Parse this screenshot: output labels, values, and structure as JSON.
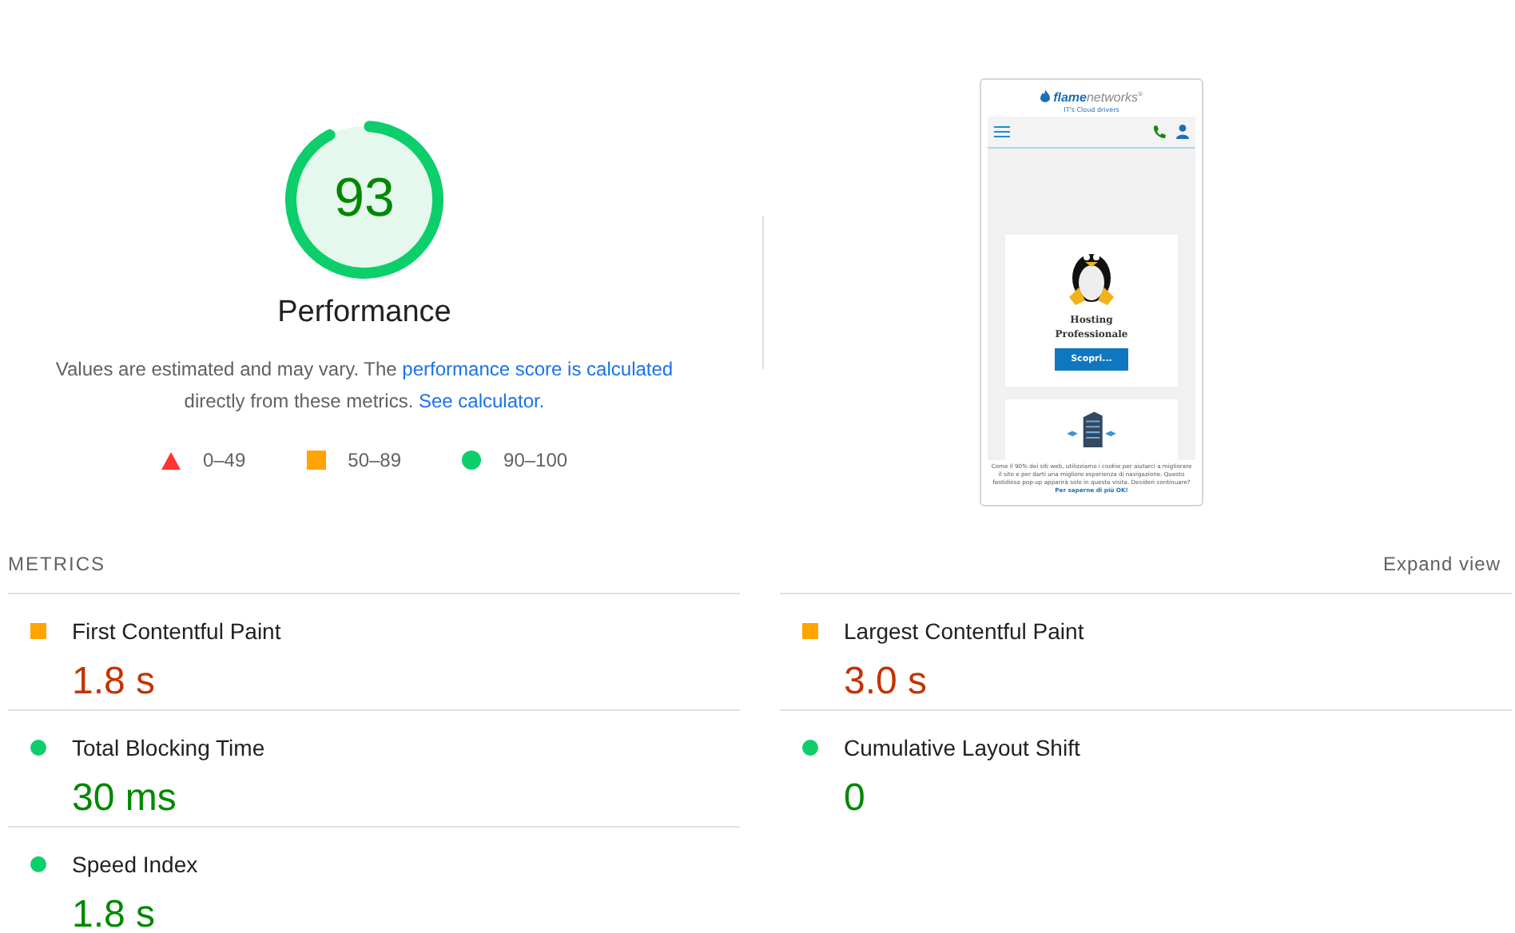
{
  "score": {
    "value": "93",
    "level": 0.93,
    "title": "Performance",
    "note": [
      {
        "kind": "text",
        "text": "Values are estimated and may vary. The "
      },
      {
        "kind": "link",
        "text": "performance score is calculated"
      },
      {
        "kind": "text",
        "text": " directly from these metrics. "
      },
      {
        "kind": "link",
        "text": "See calculator."
      }
    ],
    "legend": [
      {
        "kind": "triangle",
        "color": "#ff3333",
        "range": "0–49"
      },
      {
        "kind": "square",
        "color": "#ffa400",
        "range": "50–89"
      },
      {
        "kind": "circle",
        "color": "#0cce6b",
        "range": "90–100"
      }
    ]
  },
  "thumbnail": {
    "brand_bold": "flame",
    "brand_light": "networks",
    "brand_mark": "®",
    "tagline": "IT's Cloud drivers",
    "card_title": "Hosting Professionale",
    "card_button": "Scopri...",
    "cookie_text": "Come il 90% dei siti web, utilizziamo i cookie per aiutarci a migliorare il sito e per darti una migliore esperienza di navigazione. Questo fastidioso pop-up apparirà solo in questa visita. Desideri continuare?",
    "cookie_link": "Per saperne di più",
    "cookie_ok": "OK!"
  },
  "metrics": {
    "title": "METRICS",
    "toggle": "Expand view",
    "items": [
      {
        "label": "First Contentful Paint",
        "value": "1.8 s",
        "kind": "average"
      },
      {
        "label": "Largest Contentful Paint",
        "value": "3.0 s",
        "kind": "average"
      },
      {
        "label": "Total Blocking Time",
        "value": "30 ms",
        "kind": "pass"
      },
      {
        "label": "Cumulative Layout Shift",
        "value": "0",
        "kind": "pass"
      },
      {
        "label": "Speed Index",
        "value": "1.8 s",
        "kind": "pass"
      }
    ]
  }
}
